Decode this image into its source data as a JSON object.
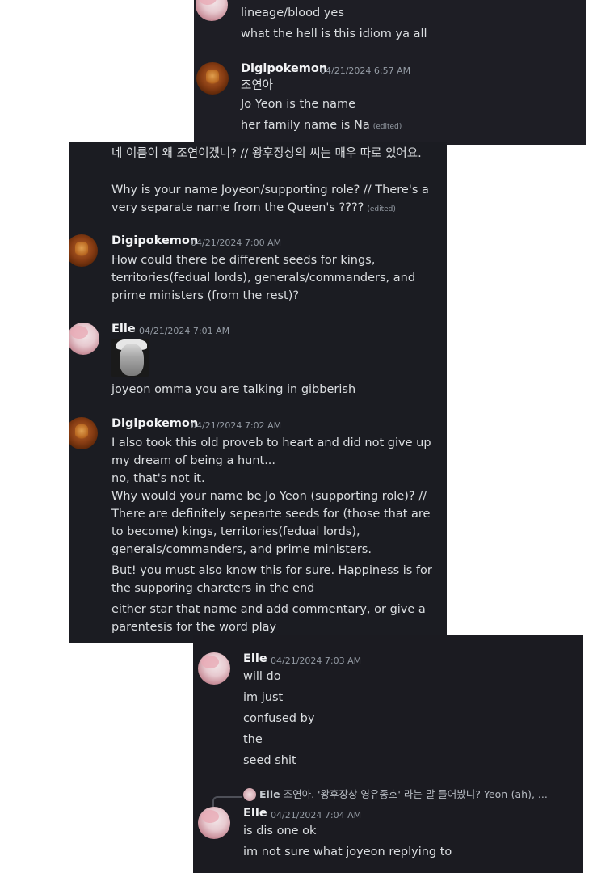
{
  "panel1": {
    "lines_top": [
      "lineage/blood yes",
      "what the hell is this idiom ya all"
    ],
    "msg": {
      "author": "Digipokemon",
      "time": "04/21/2024 6:57 AM",
      "lines": [
        "조연아",
        "Jo Yeon  is the name",
        "her family name is Na"
      ],
      "edited": "(edited)"
    }
  },
  "panel2": {
    "continued": {
      "korean": "네 이름이 왜 조연이겠니? // 왕후장상의 씨는 매우 따로 있어요.",
      "english": "Why is your name Joyeon/supporting role? // There's a very separate name from the Queen's ????",
      "edited": "(edited)"
    },
    "msg1": {
      "author": "Digipokemon",
      "time": "04/21/2024 7:00 AM",
      "text": "How could there be different seeds for kings, territories(fedual lords),  generals/commanders, and prime ministers (from the rest)?"
    },
    "msg2": {
      "author": "Elle",
      "time": "04/21/2024 7:01 AM",
      "text": "joyeon omma you are talking in gibberish"
    },
    "msg3": {
      "author": "Digipokemon",
      "time": "04/21/2024 7:02 AM",
      "line1": "I also took this old proveb to heart and did not give up my dream of being a hunt...",
      "line2": "no, that's not it.",
      "line3": "Why would your name be Jo Yeon (supporting role)? // There are definitely sepearte seeds for (those that are to become) kings, territories(fedual lords), generals/commanders, and prime ministers.",
      "line4": "But! you must also know this for sure. Happiness is for the supporing charcters in the end",
      "line5": "either star that name and add commentary, or give a parentesis for the word play"
    }
  },
  "panel3": {
    "msg1": {
      "author": "Elle",
      "time": "04/21/2024 7:03 AM",
      "lines": [
        "will do",
        "im just",
        "confused by",
        "the",
        "seed shit"
      ]
    },
    "reply": {
      "author": "Elle",
      "preview": "조연아. '왕후장상 영유종호' 라는 말 들어봤니? Yeon-(ah), ..."
    },
    "msg2": {
      "author": "Elle",
      "time": "04/21/2024 7:04 AM",
      "lines": [
        "is dis one ok",
        "im not sure what joyeon replying to"
      ]
    }
  }
}
